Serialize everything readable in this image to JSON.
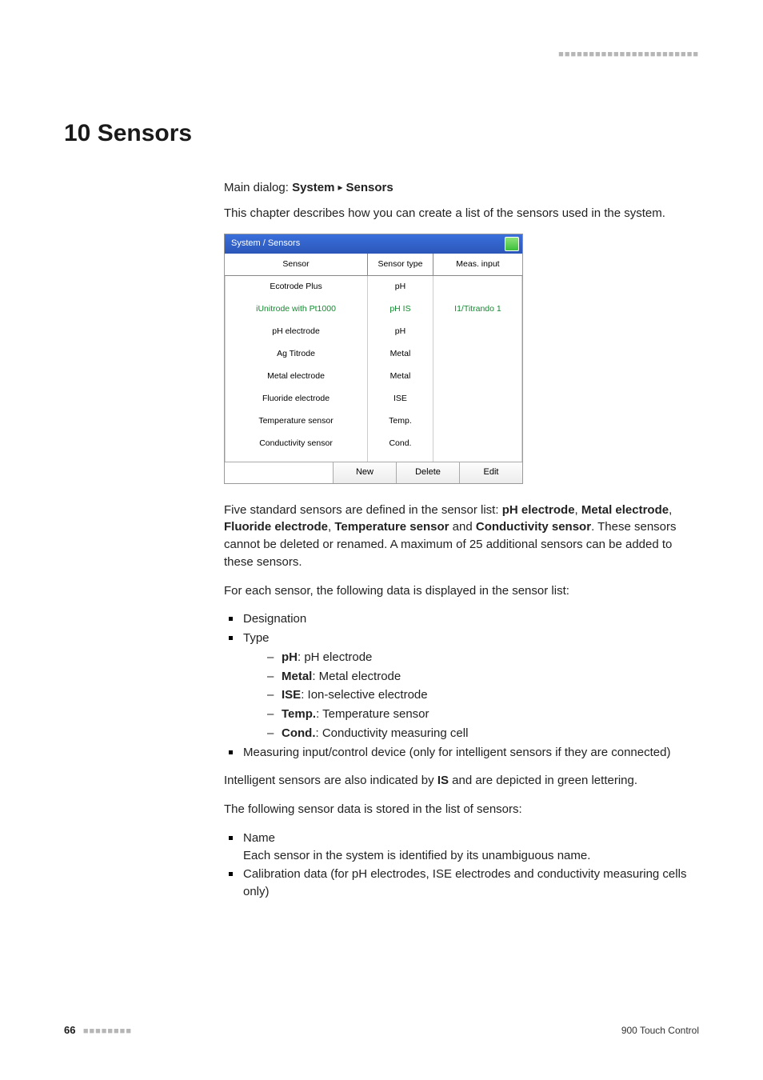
{
  "header": {
    "dots": "■■■■■■■■■■■■■■■■■■■■■■■"
  },
  "chapter": {
    "title": "10 Sensors"
  },
  "breadcrumb": {
    "prefix": "Main dialog: ",
    "a": "System",
    "b": "Sensors"
  },
  "intro": "This chapter describes how you can create a list of the sensors used in the system.",
  "dialog": {
    "title": "System / Sensors",
    "columns": {
      "c1": "Sensor",
      "c2": "Sensor type",
      "c3": "Meas. input"
    },
    "rows": [
      {
        "sensor": "Ecotrode Plus",
        "type": "pH",
        "input": "",
        "intelligent": false
      },
      {
        "sensor": "iUnitrode with Pt1000",
        "type": "pH IS",
        "input": "I1/Titrando 1",
        "intelligent": true
      },
      {
        "sensor": "pH electrode",
        "type": "pH",
        "input": "",
        "intelligent": false
      },
      {
        "sensor": "Ag Titrode",
        "type": "Metal",
        "input": "",
        "intelligent": false
      },
      {
        "sensor": "Metal electrode",
        "type": "Metal",
        "input": "",
        "intelligent": false
      },
      {
        "sensor": "Fluoride electrode",
        "type": "ISE",
        "input": "",
        "intelligent": false
      },
      {
        "sensor": "Temperature sensor",
        "type": "Temp.",
        "input": "",
        "intelligent": false
      },
      {
        "sensor": "Conductivity sensor",
        "type": "Cond.",
        "input": "",
        "intelligent": false
      }
    ],
    "buttons": {
      "new": "New",
      "delete": "Delete",
      "edit": "Edit"
    }
  },
  "para_standard": {
    "t1": "Five standard sensors are defined in the sensor list: ",
    "b1": "pH electrode",
    "s1": ", ",
    "b2": "Metal electrode",
    "s2": ", ",
    "b3": "Fluoride electrode",
    "s3": ", ",
    "b4": "Temperature sensor",
    "s4": " and ",
    "b5": "Conductivity sensor",
    "t2": ". These sensors cannot be deleted or renamed. A maximum of 25 additional sensors can be added to these sensors."
  },
  "para_foreach": "For each sensor, the following data is displayed in the sensor list:",
  "list1": {
    "designation": "Designation",
    "type": "Type",
    "types": {
      "ph": {
        "b": "pH",
        "t": ": pH electrode"
      },
      "metal": {
        "b": "Metal",
        "t": ": Metal electrode"
      },
      "ise": {
        "b": "ISE",
        "t": ": Ion-selective electrode"
      },
      "temp": {
        "b": "Temp.",
        "t": ": Temperature sensor"
      },
      "cond": {
        "b": "Cond.",
        "t": ": Conductivity measuring cell"
      }
    },
    "measuring": "Measuring input/control device (only for intelligent sensors if they are connected)"
  },
  "para_intelligent": {
    "t1": "Intelligent sensors are also indicated by ",
    "b1": "IS",
    "t2": " and are depicted in green lettering."
  },
  "para_stored": "The following sensor data is stored in the list of sensors:",
  "list2": {
    "name": "Name",
    "name_desc": "Each sensor in the system is identified by its unambiguous name.",
    "calib": "Calibration data (for pH electrodes, ISE electrodes and conductivity measuring cells only)"
  },
  "footer": {
    "page": "66",
    "dots": "■■■■■■■■",
    "product": "900 Touch Control"
  }
}
